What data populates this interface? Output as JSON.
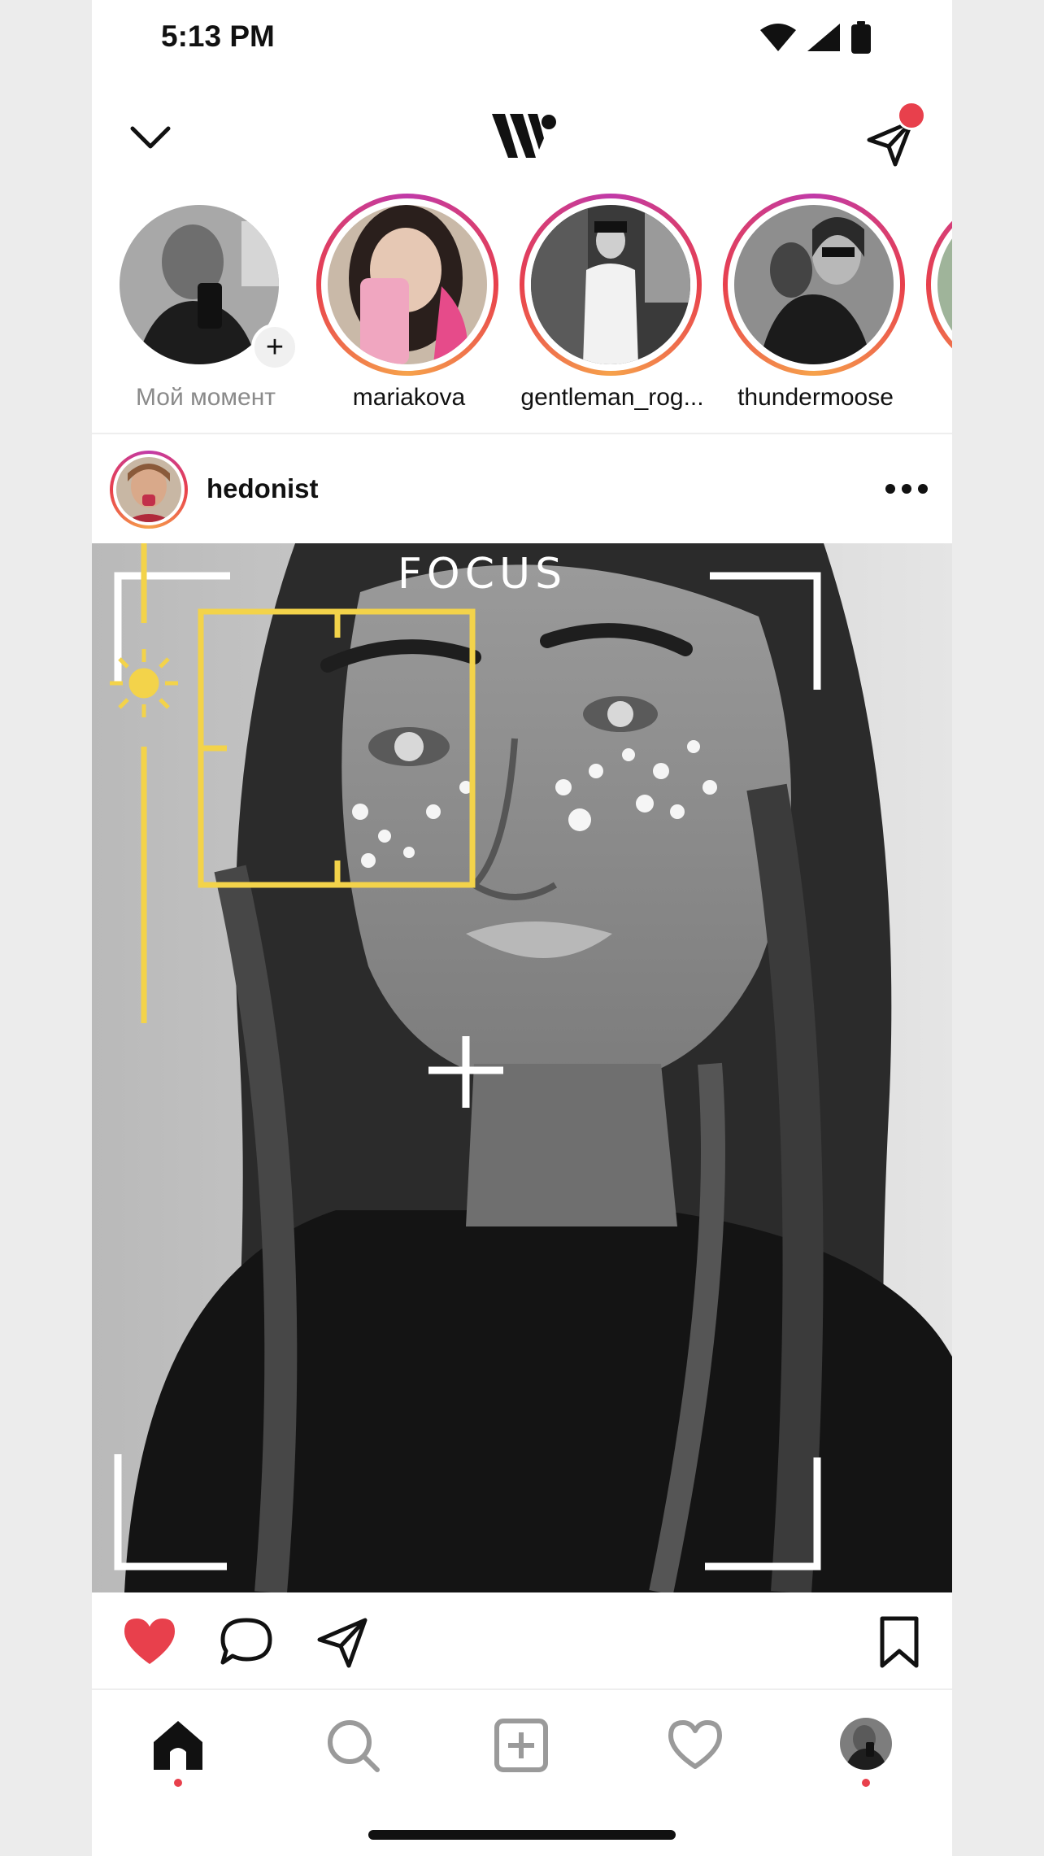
{
  "status_bar": {
    "time": "5:13 PM",
    "icons": [
      "wifi-icon",
      "cellular-icon",
      "battery-icon"
    ]
  },
  "header": {
    "left_icon": "chevron-down-icon",
    "logo_icon": "app-logo-icon",
    "right_icon": "direct-send-icon",
    "has_notification_badge": true
  },
  "stories": [
    {
      "label": "Мой момент",
      "own": true
    },
    {
      "label": "mariakova",
      "own": false
    },
    {
      "label": "gentleman_rog...",
      "own": false
    },
    {
      "label": "thundermoose",
      "own": false
    },
    {
      "label": "",
      "own": false
    }
  ],
  "post": {
    "username": "hedonist",
    "overlay_text": "FOCUS",
    "liked": true,
    "actions": [
      "heart-icon",
      "comment-icon",
      "share-icon",
      "bookmark-icon"
    ]
  },
  "bottom_nav": [
    {
      "name": "home",
      "active": true,
      "dot": true
    },
    {
      "name": "search",
      "active": false,
      "dot": false
    },
    {
      "name": "create",
      "active": false,
      "dot": false
    },
    {
      "name": "activity",
      "active": false,
      "dot": false
    },
    {
      "name": "profile",
      "active": false,
      "dot": true
    }
  ],
  "colors": {
    "accent_red": "#e8404c",
    "focus_yellow": "#f3d34a",
    "text": "#111111",
    "muted": "#8a8a8a"
  }
}
